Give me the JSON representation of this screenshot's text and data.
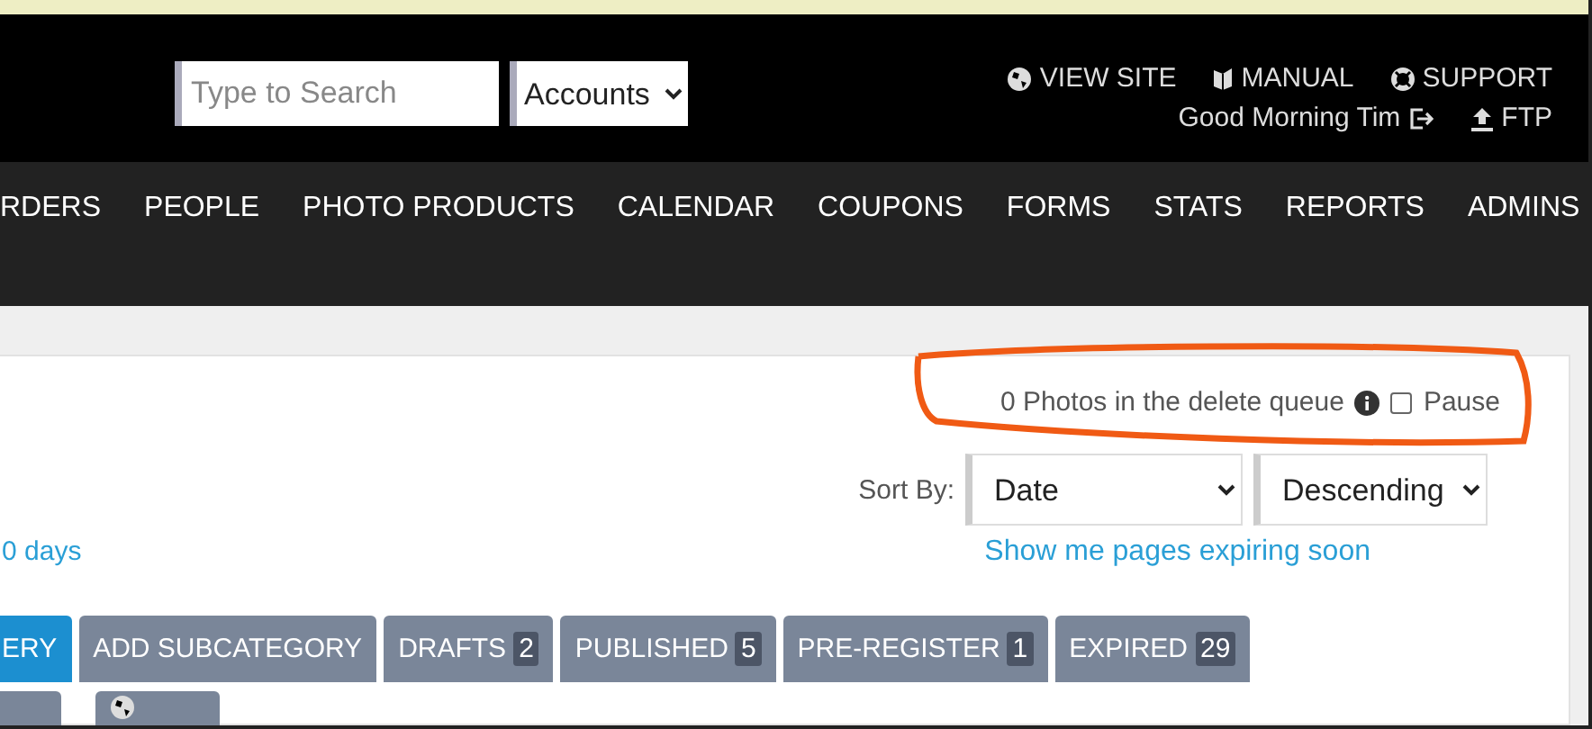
{
  "header": {
    "search": {
      "placeholder": "Type to Search"
    },
    "scope_select": {
      "value": "Accounts"
    },
    "links": [
      {
        "kind": "globe",
        "label": "VIEW SITE"
      },
      {
        "kind": "book",
        "label": "MANUAL"
      },
      {
        "kind": "lifebuoy",
        "label": "SUPPORT"
      }
    ],
    "greeting": "Good Morning Tim",
    "ftp": "FTP"
  },
  "nav": [
    "RDERS",
    "PEOPLE",
    "PHOTO PRODUCTS",
    "CALENDAR",
    "COUPONS",
    "FORMS",
    "STATS",
    "REPORTS",
    "ADMINS"
  ],
  "queue": {
    "text": "0 Photos in the delete queue",
    "pause_label": "Pause",
    "paused": false
  },
  "expiry_link": "0 days",
  "sort": {
    "label": "Sort By:",
    "field": "Date",
    "order": "Descending",
    "expiring_link": "Show me pages expiring soon"
  },
  "tabs": [
    {
      "label": "ERY",
      "selected": true
    },
    {
      "label": "ADD SUBCATEGORY",
      "selected": false
    },
    {
      "label": "DRAFTS",
      "count": "2",
      "selected": false
    },
    {
      "label": "PUBLISHED",
      "count": "5",
      "selected": false
    },
    {
      "label": "PRE-REGISTER",
      "count": "1",
      "selected": false
    },
    {
      "label": "EXPIRED",
      "count": "29",
      "selected": false
    }
  ],
  "lower_buttons": [
    {
      "kind": "plain"
    },
    {
      "kind": "globe"
    }
  ]
}
